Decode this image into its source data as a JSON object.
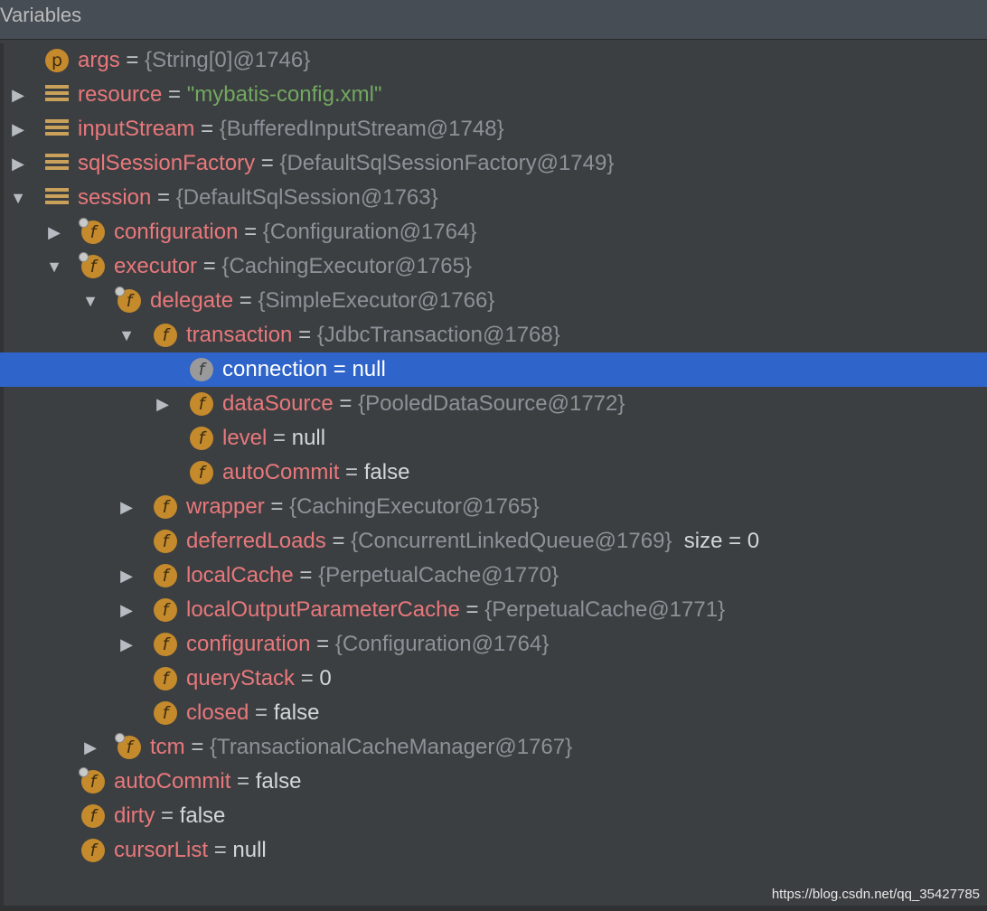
{
  "panel": {
    "title": "Variables"
  },
  "rows": [
    {
      "name": "args",
      "eq": " = ",
      "value": "{String[0]@1746}",
      "valueType": "obj",
      "icon": "p"
    },
    {
      "name": "resource",
      "eq": " = ",
      "value": "\"mybatis-config.xml\"",
      "valueType": "str",
      "icon": "list",
      "expand": "right"
    },
    {
      "name": "inputStream",
      "eq": " = ",
      "value": "{BufferedInputStream@1748}",
      "valueType": "obj",
      "icon": "list",
      "expand": "right"
    },
    {
      "name": "sqlSessionFactory",
      "eq": " = ",
      "value": "{DefaultSqlSessionFactory@1749}",
      "valueType": "obj",
      "icon": "list",
      "expand": "right"
    },
    {
      "name": "session",
      "eq": " = ",
      "value": "{DefaultSqlSession@1763}",
      "valueType": "obj",
      "icon": "list",
      "expand": "down"
    },
    {
      "name": "configuration",
      "eq": " = ",
      "value": "{Configuration@1764}",
      "valueType": "obj",
      "icon": "f-badge",
      "expand": "right"
    },
    {
      "name": "executor",
      "eq": " = ",
      "value": "{CachingExecutor@1765}",
      "valueType": "obj",
      "icon": "f-badge",
      "expand": "down"
    },
    {
      "name": "delegate",
      "eq": " = ",
      "value": "{SimpleExecutor@1766}",
      "valueType": "obj",
      "icon": "f-badge",
      "expand": "down"
    },
    {
      "name": "transaction",
      "eq": " = ",
      "value": "{JdbcTransaction@1768}",
      "valueType": "obj",
      "icon": "f",
      "expand": "down"
    },
    {
      "name": "connection",
      "eq": " = ",
      "value": "null",
      "valueType": "plain",
      "icon": "f-gray",
      "selected": true
    },
    {
      "name": "dataSource",
      "eq": " = ",
      "value": "{PooledDataSource@1772}",
      "valueType": "obj",
      "icon": "f",
      "expand": "right"
    },
    {
      "name": "level",
      "eq": " = ",
      "value": "null",
      "valueType": "plain",
      "icon": "f"
    },
    {
      "name": "autoCommit",
      "eq": " = ",
      "value": "false",
      "valueType": "plain",
      "icon": "f"
    },
    {
      "name": "wrapper",
      "eq": " = ",
      "value": "{CachingExecutor@1765}",
      "valueType": "obj",
      "icon": "f",
      "expand": "right"
    },
    {
      "name": "deferredLoads",
      "eq": " = ",
      "value": "{ConcurrentLinkedQueue@1769}",
      "valueType": "obj",
      "icon": "f",
      "extra": "  size = 0"
    },
    {
      "name": "localCache",
      "eq": " = ",
      "value": "{PerpetualCache@1770}",
      "valueType": "obj",
      "icon": "f",
      "expand": "right"
    },
    {
      "name": "localOutputParameterCache",
      "eq": " = ",
      "value": "{PerpetualCache@1771}",
      "valueType": "obj",
      "icon": "f",
      "expand": "right"
    },
    {
      "name": "configuration",
      "eq": " = ",
      "value": "{Configuration@1764}",
      "valueType": "obj",
      "icon": "f",
      "expand": "right"
    },
    {
      "name": "queryStack",
      "eq": " = ",
      "value": "0",
      "valueType": "plain",
      "icon": "f"
    },
    {
      "name": "closed",
      "eq": " = ",
      "value": "false",
      "valueType": "plain",
      "icon": "f"
    },
    {
      "name": "tcm",
      "eq": " = ",
      "value": "{TransactionalCacheManager@1767}",
      "valueType": "obj",
      "icon": "f-badge",
      "expand": "right"
    },
    {
      "name": "autoCommit",
      "eq": " = ",
      "value": "false",
      "valueType": "plain",
      "icon": "f-badge"
    },
    {
      "name": "dirty",
      "eq": " = ",
      "value": "false",
      "valueType": "plain",
      "icon": "f"
    },
    {
      "name": "cursorList",
      "eq": " = ",
      "value": "null",
      "valueType": "plain",
      "icon": "f"
    }
  ],
  "watermark": "https://blog.csdn.net/qq_35427785"
}
